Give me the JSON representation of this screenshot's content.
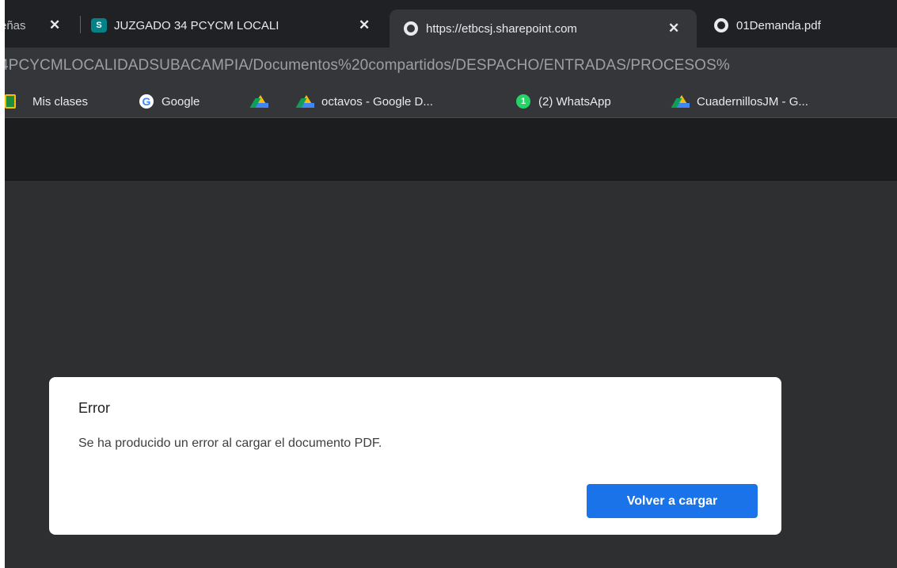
{
  "tabs": [
    {
      "title": "eñas",
      "close": "✕"
    },
    {
      "title": "JUZGADO 34 PCYCM LOCALI",
      "favicon": "S",
      "close": "✕"
    },
    {
      "title": "https://etbcsj.sharepoint.com",
      "close": "✕"
    },
    {
      "title": "01Demanda.pdf"
    }
  ],
  "address_bar": {
    "url": "4PCYCMLOCALIDADSUBACAMPIA/Documentos%20compartidos/DESPACHO/ENTRADAS/PROCESOS%"
  },
  "bookmarks": [
    {
      "label": "Mis clases",
      "icon": "classroom-icon"
    },
    {
      "label": "Google",
      "icon": "google-icon"
    },
    {
      "label": "",
      "icon": "drive-icon"
    },
    {
      "label": "octavos - Google D...",
      "icon": "drive-icon"
    },
    {
      "label": "(2) WhatsApp",
      "icon": "whatsapp-icon",
      "badge": "1"
    },
    {
      "label": "CuadernillosJM - G...",
      "icon": "drive-icon"
    }
  ],
  "dialog": {
    "title": "Error",
    "message": "Se ha producido un error al cargar el documento PDF.",
    "button": "Volver a cargar"
  },
  "colors": {
    "accent": "#1a73e8",
    "tabstrip": "#202124",
    "toolbar": "#35363a"
  }
}
